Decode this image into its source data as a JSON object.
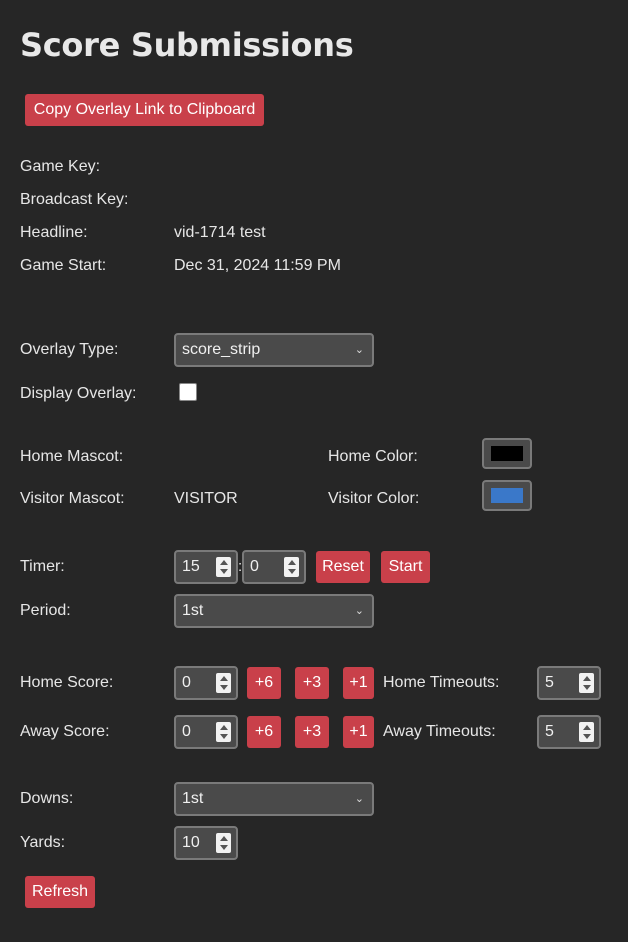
{
  "page": {
    "title": "Score Submissions"
  },
  "actions": {
    "copy_link": "Copy Overlay Link to Clipboard",
    "refresh": "Refresh"
  },
  "info": {
    "game_key_label": "Game Key:",
    "game_key_value": "",
    "broadcast_key_label": "Broadcast Key:",
    "broadcast_key_value": "",
    "headline_label": "Headline:",
    "headline_value": "vid-1714 test",
    "game_start_label": "Game Start:",
    "game_start_value": "Dec 31, 2024 11:59 PM"
  },
  "overlay": {
    "type_label": "Overlay Type:",
    "type_value": "score_strip",
    "display_label": "Display Overlay:",
    "display_checked": false
  },
  "teams": {
    "home_mascot_label": "Home Mascot:",
    "home_mascot_value": "",
    "visitor_mascot_label": "Visitor Mascot:",
    "visitor_mascot_value": "VISITOR",
    "home_color_label": "Home Color:",
    "home_color": "#000000",
    "visitor_color_label": "Visitor Color:",
    "visitor_color": "#3a78c9"
  },
  "timer": {
    "label": "Timer:",
    "minutes": "15",
    "separator": ":",
    "seconds": "0",
    "reset_label": "Reset",
    "start_label": "Start"
  },
  "period": {
    "label": "Period:",
    "value": "1st"
  },
  "score": {
    "home_label": "Home Score:",
    "home_value": "0",
    "away_label": "Away Score:",
    "away_value": "0",
    "plus6": "+6",
    "plus3": "+3",
    "plus1": "+1",
    "home_timeouts_label": "Home Timeouts:",
    "home_timeouts": "5",
    "away_timeouts_label": "Away Timeouts:",
    "away_timeouts": "5"
  },
  "downs": {
    "label": "Downs:",
    "value": "1st"
  },
  "yards": {
    "label": "Yards:",
    "value": "10"
  },
  "icons": {
    "select_arrow": "chevron-down-icon",
    "spinner": "spinner-icon"
  },
  "colors": {
    "background": "#262626",
    "accent": "#c9404a",
    "field": "#4a4a4a"
  }
}
